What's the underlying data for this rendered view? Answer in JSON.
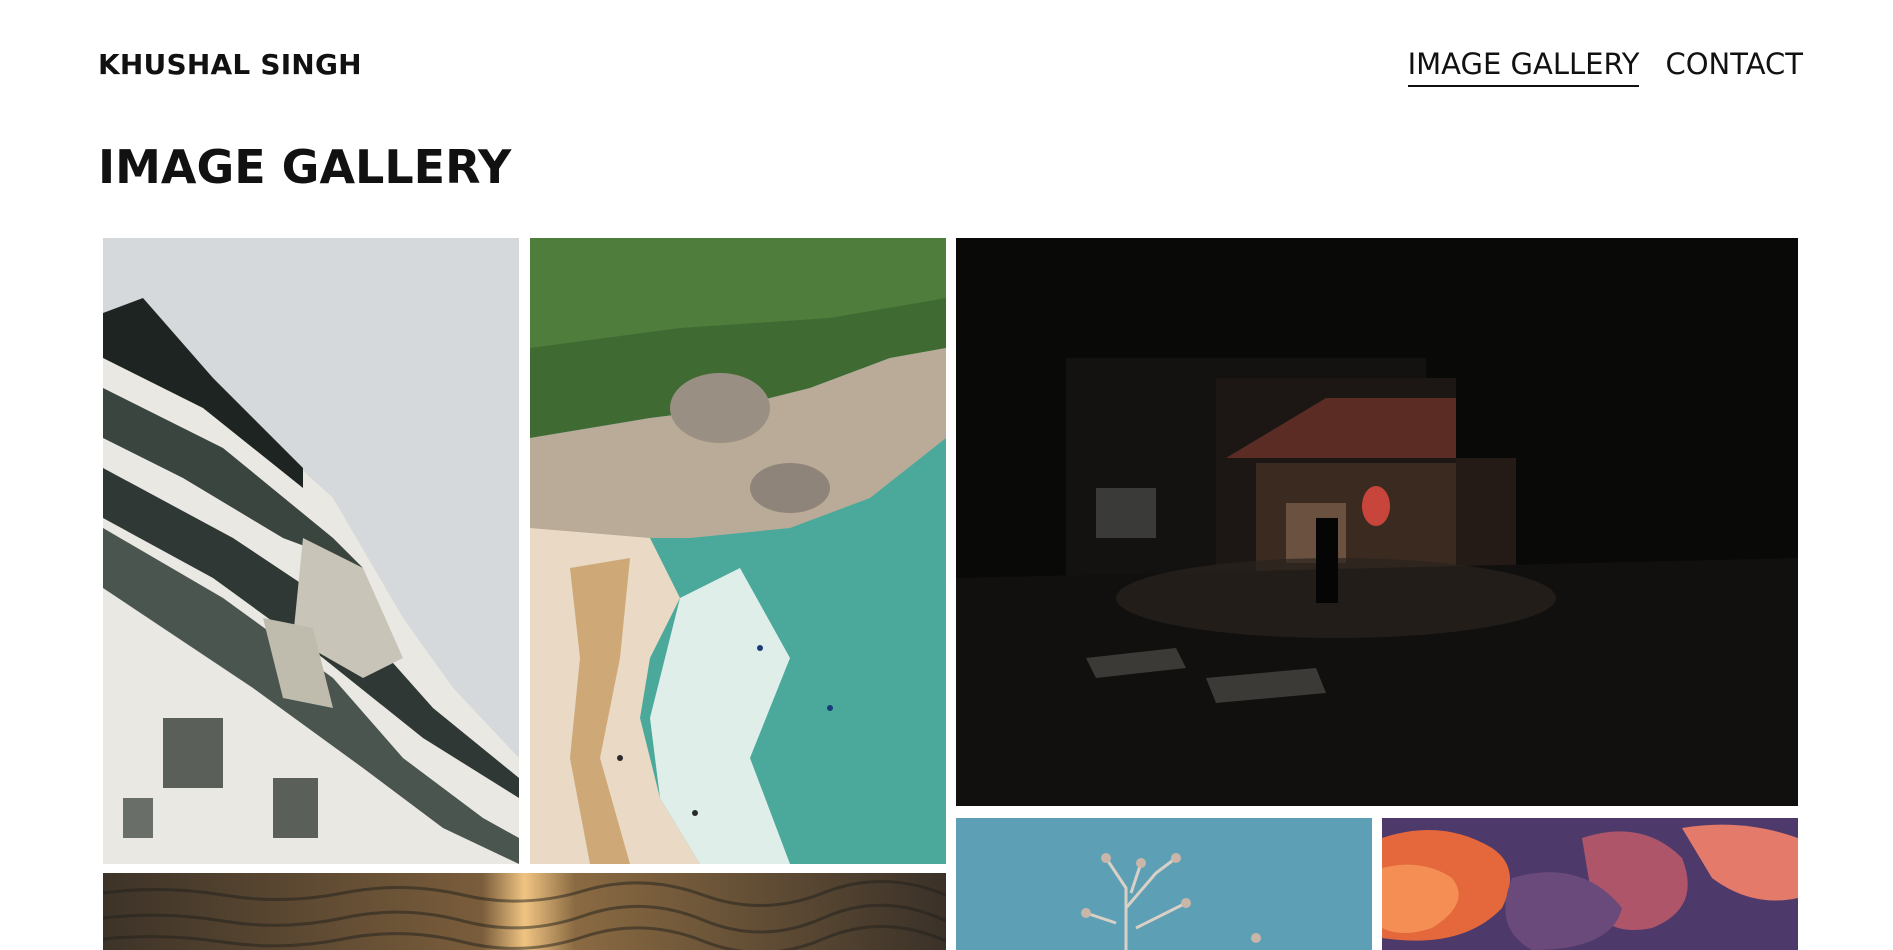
{
  "header": {
    "brand": "KHUSHAL SINGH",
    "nav": [
      {
        "label": "IMAGE GALLERY",
        "active": true
      },
      {
        "label": "CONTACT",
        "active": false
      }
    ]
  },
  "main": {
    "title": "IMAGE GALLERY"
  },
  "gallery": {
    "images": [
      {
        "subject": "japanese-castle"
      },
      {
        "subject": "beach-cove"
      },
      {
        "subject": "night-street"
      },
      {
        "subject": "sunset-sea"
      },
      {
        "subject": "dry-plant-blue-sky"
      },
      {
        "subject": "sunset-clouds"
      }
    ]
  },
  "colors": {
    "text": "#111111",
    "background": "#ffffff"
  }
}
